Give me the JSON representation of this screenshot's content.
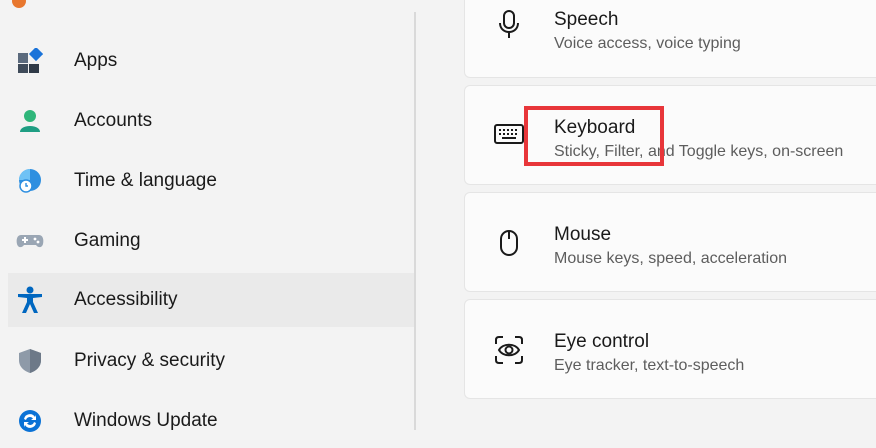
{
  "sidebar": {
    "items": [
      {
        "label": "Apps",
        "icon": "apps-icon"
      },
      {
        "label": "Accounts",
        "icon": "accounts-icon"
      },
      {
        "label": "Time & language",
        "icon": "globe-clock-icon"
      },
      {
        "label": "Gaming",
        "icon": "gamepad-icon"
      },
      {
        "label": "Accessibility",
        "icon": "accessibility-icon",
        "hovered": true
      },
      {
        "label": "Privacy & security",
        "icon": "shield-icon"
      },
      {
        "label": "Windows Update",
        "icon": "update-icon"
      }
    ]
  },
  "cards": [
    {
      "title": "Speech",
      "subtitle": "Voice access, voice typing",
      "icon": "microphone-icon"
    },
    {
      "title": "Keyboard",
      "subtitle": "Sticky, Filter, and Toggle keys, on-screen",
      "icon": "keyboard-icon"
    },
    {
      "title": "Mouse",
      "subtitle": "Mouse keys, speed, acceleration",
      "icon": "mouse-icon"
    },
    {
      "title": "Eye control",
      "subtitle": "Eye tracker, text-to-speech",
      "icon": "eye-control-icon"
    }
  ],
  "colors": {
    "highlight": "#e8363a",
    "accent_blue": "#0067c0",
    "hover_bg": "#eaeaea"
  }
}
